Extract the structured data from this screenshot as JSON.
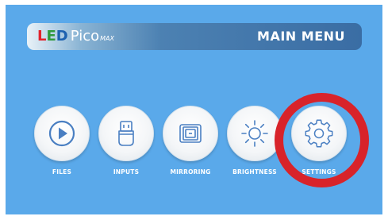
{
  "header": {
    "logo": {
      "l": "L",
      "e": "E",
      "d": "D",
      "pico": "Pico",
      "max": "MAX"
    },
    "title": "MAIN MENU"
  },
  "menu": {
    "items": [
      {
        "label": "FILES",
        "icon": "play-icon"
      },
      {
        "label": "INPUTS",
        "icon": "usb-plug-icon"
      },
      {
        "label": "MIRRORING",
        "icon": "tablet-mirror-icon"
      },
      {
        "label": "BRIGHTNESS",
        "icon": "sun-icon"
      },
      {
        "label": "SETTINGS",
        "icon": "gear-icon"
      }
    ]
  },
  "annotation": {
    "highlight_color": "#d8232a",
    "highlighted_item": "SETTINGS"
  },
  "colors": {
    "background": "#5aa9ea",
    "icon": "#4a7fc2",
    "label": "#ffffff"
  }
}
